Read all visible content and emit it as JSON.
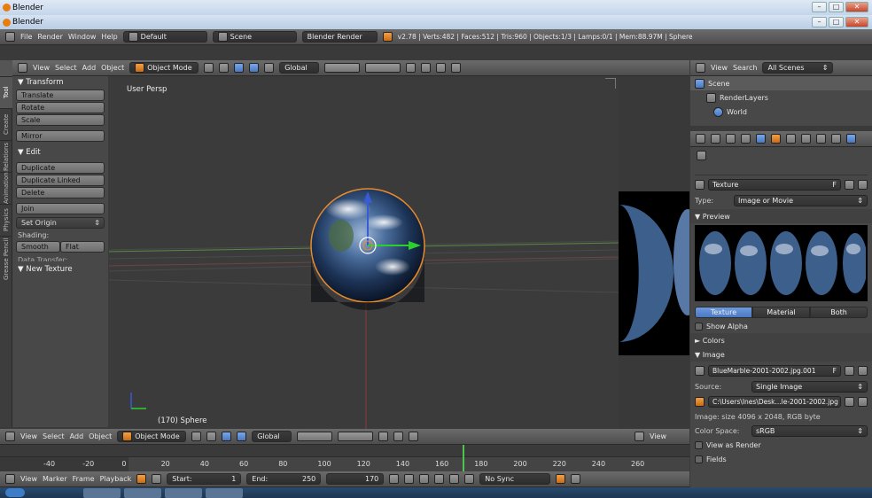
{
  "window": {
    "outer_title": "Blender",
    "inner_title": "Blender",
    "controls": [
      "–",
      "□",
      "✕"
    ]
  },
  "info_bar": {
    "menus": [
      "File",
      "Render",
      "Window",
      "Help"
    ],
    "layout": "Default",
    "scene": "Scene",
    "engine": "Blender Render",
    "stats": "v2.78 | Verts:482 | Faces:512 | Tris:960 | Objects:1/3 | Lamps:0/1 | Mem:88.97M | Sphere"
  },
  "view3d_header": {
    "menus": [
      "View",
      "Select",
      "Add",
      "Object"
    ],
    "mode": "Object Mode",
    "orientation": "Global"
  },
  "tool_shelf": {
    "tabs": [
      "Tool",
      "Create",
      "Relations",
      "Animation",
      "Physics",
      "Grease Pencil"
    ],
    "transform_header": "▼ Transform",
    "transform_buttons": [
      "Translate",
      "Rotate",
      "Scale"
    ],
    "mirror": "Mirror",
    "edit_header": "▼ Edit",
    "edit_buttons": [
      "Duplicate",
      "Duplicate Linked",
      "Delete"
    ],
    "join": "Join",
    "set_origin": "Set Origin",
    "shading_label": "Shading:",
    "smooth": "Smooth",
    "flat": "Flat",
    "data_transfer": "Data Transfer:",
    "new_texture": "▼ New Texture"
  },
  "viewport": {
    "label": "User Persp",
    "object_label": "(170) Sphere"
  },
  "outliner": {
    "header_menus": [
      "View",
      "Search"
    ],
    "filter": "All Scenes",
    "items": [
      "Scene",
      "RenderLayers",
      "World"
    ]
  },
  "properties": {
    "texture_name": "Texture",
    "texture_flag": "F",
    "type_label": "Type:",
    "type_value": "Image or Movie",
    "preview_header": "▼ Preview",
    "preview_tabs": [
      "Texture",
      "Material",
      "Both"
    ],
    "show_alpha": "Show Alpha",
    "colors_header": "► Colors",
    "image_header": "▼ Image",
    "image_name": "BlueMarble-2001-2002.jpg.001",
    "image_flag": "F",
    "source_label": "Source:",
    "source_value": "Single Image",
    "file_path": "C:\\Users\\Ines\\Desk...le-2001-2002.jpg",
    "image_info": "Image: size 4096 x 2048, RGB byte",
    "color_space_label": "Color Space:",
    "color_space_value": "sRGB",
    "view_as_render": "View as Render",
    "fields": "Fields"
  },
  "timeline": {
    "ticks": [
      "-40",
      "-20",
      "0",
      "20",
      "40",
      "60",
      "80",
      "100",
      "120",
      "140",
      "160",
      "180",
      "200",
      "220",
      "240",
      "260"
    ],
    "current_frame_marker": 170,
    "menus": [
      "View",
      "Marker",
      "Frame",
      "Playback"
    ],
    "start_label": "Start:",
    "start_value": "1",
    "end_label": "End:",
    "end_value": "250",
    "current_frame": "170",
    "sync": "No Sync"
  },
  "bottom_view3d_header": {
    "menus": [
      "View",
      "Select",
      "Add",
      "Object"
    ],
    "mode": "Object Mode",
    "orientation": "Global",
    "extra_view": "View"
  },
  "colors": {
    "accent_blue": "#5680c2",
    "orange": "#e87d0d",
    "viewport_bg": "#3b3b3b"
  }
}
